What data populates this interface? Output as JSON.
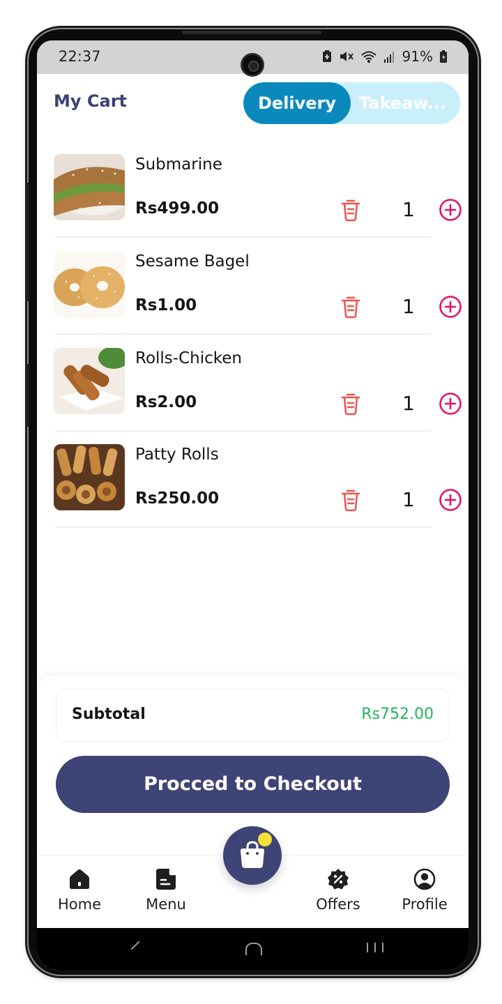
{
  "status_bar": {
    "time": "22:37",
    "battery": "91%"
  },
  "header": {
    "title": "My Cart",
    "toggle": {
      "active": "Delivery",
      "inactive": "Takeaw..."
    }
  },
  "cart": {
    "items": [
      {
        "name": "Submarine",
        "price": "Rs499.00",
        "qty": "1"
      },
      {
        "name": "Sesame Bagel",
        "price": "Rs1.00",
        "qty": "1"
      },
      {
        "name": "Rolls-Chicken",
        "price": "Rs2.00",
        "qty": "1"
      },
      {
        "name": "Patty Rolls",
        "price": "Rs250.00",
        "qty": "1"
      }
    ]
  },
  "summary": {
    "subtotal_label": "Subtotal",
    "subtotal_value": "Rs752.00",
    "checkout_label": "Procced to Checkout"
  },
  "bottom_nav": {
    "items": [
      {
        "label": "Home",
        "icon": "home-icon"
      },
      {
        "label": "Menu",
        "icon": "menu-icon"
      },
      {
        "label": "Offers",
        "icon": "offers-icon"
      },
      {
        "label": "Profile",
        "icon": "profile-icon"
      }
    ],
    "center_icon": "shopping-bag-icon"
  },
  "colors": {
    "brand": "#3e4476",
    "toggle_active": "#0a89bd",
    "toggle_bg": "#c9effb",
    "delete": "#f0524d",
    "add": "#e3126c",
    "subtotal": "#23b35c"
  }
}
